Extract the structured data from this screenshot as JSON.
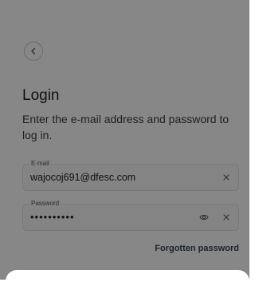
{
  "login": {
    "title": "Login",
    "subtitle": "Enter the e-mail address and password to log in.",
    "email": {
      "label": "E-mail",
      "value": "wajocoj691@dfesc.com"
    },
    "password": {
      "label": "Password",
      "value": "••••••••••"
    },
    "forgotten_link": "Forgotten password"
  },
  "icons": {
    "back": "chevron-left-icon",
    "clear": "close-icon",
    "visibility": "eye-icon"
  },
  "colors": {
    "overlay": "#000000",
    "link": "#3a4452"
  }
}
